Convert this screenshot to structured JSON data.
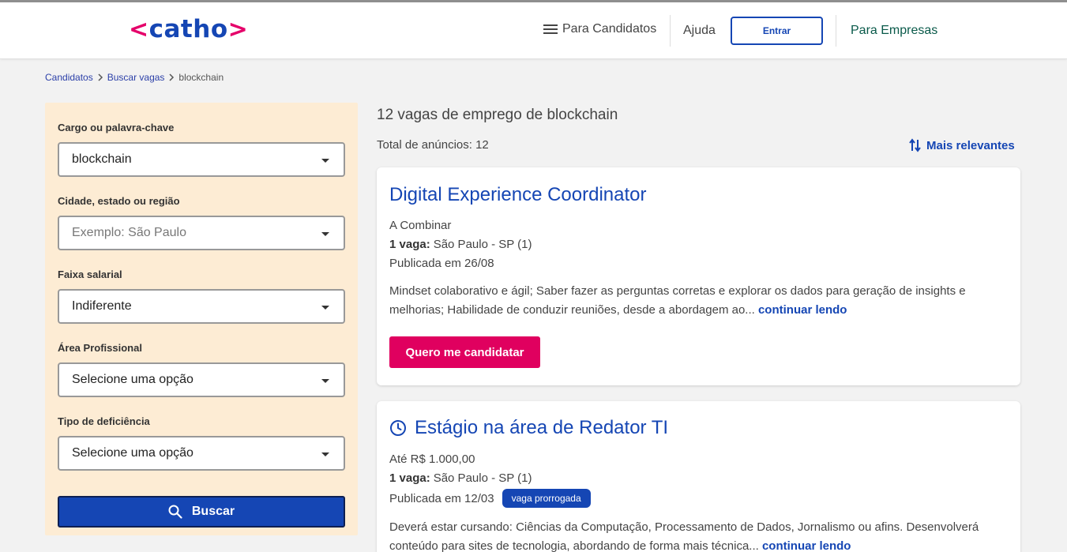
{
  "header": {
    "logo_text": "catho",
    "logo_left": "<",
    "logo_right": ">",
    "nav_candidatos": "Para Candidatos",
    "nav_ajuda": "Ajuda",
    "entrar_label": "Entrar",
    "nav_empresas": "Para Empresas"
  },
  "breadcrumb": {
    "items": [
      "Candidatos",
      "Buscar vagas"
    ],
    "current": "blockchain"
  },
  "filters": {
    "cargo": {
      "label": "Cargo ou palavra-chave",
      "value": "blockchain"
    },
    "cidade": {
      "label": "Cidade, estado ou região",
      "placeholder": "Exemplo: São Paulo"
    },
    "faixa": {
      "label": "Faixa salarial",
      "value": "Indiferente"
    },
    "area": {
      "label": "Área Profissional",
      "value": "Selecione uma opção"
    },
    "deficiencia": {
      "label": "Tipo de deficiência",
      "value": "Selecione uma opção"
    },
    "buscar_label": "Buscar"
  },
  "results": {
    "title": "12 vagas de emprego de blockchain",
    "total": "Total de anúncios: 12",
    "sort_label": "Mais relevantes"
  },
  "jobs": [
    {
      "title": "Digital Experience Coordinator",
      "salary": "A Combinar",
      "vagas_label": "1 vaga:",
      "location": "São Paulo - SP (1)",
      "published": "Publicada em 26/08",
      "description": "Mindset colaborativo e ágil; Saber fazer as perguntas corretas e explorar os dados para geração de insights e melhorias; Habilidade de conduzir reuniões, desde a abordagem ao...",
      "more": "continuar lendo",
      "apply_label": "Quero me candidatar"
    },
    {
      "title": "Estágio na área de Redator TI",
      "salary": "Até R$ 1.000,00",
      "vagas_label": "1 vaga:",
      "location": "São Paulo - SP (1)",
      "published": "Publicada em 12/03",
      "badge": "vaga prorrogada",
      "description": "Deverá estar cursando: Ciências da Computação, Processamento de Dados, Jornalismo ou afins. Desenvolverá conteúdo para sites de tecnologia, abordando de forma mais técnica...",
      "more": "continuar lendo"
    }
  ],
  "colors": {
    "brand_blue": "#1546b4",
    "brand_pink": "#e0005f",
    "filter_bg": "#fdecd4"
  }
}
